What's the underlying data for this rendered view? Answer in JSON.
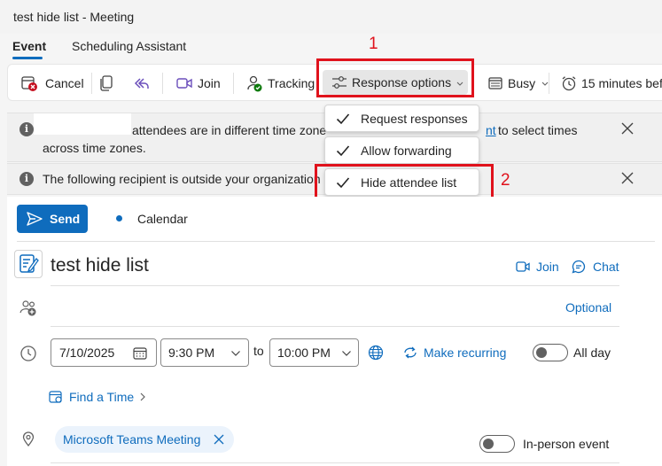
{
  "window": {
    "title": "test hide list - Meeting"
  },
  "tabs": [
    {
      "label": "Event",
      "active": true
    },
    {
      "label": "Scheduling Assistant",
      "active": false
    }
  ],
  "toolbar": {
    "cancel_label": "Cancel",
    "join_label": "Join",
    "tracking_label": "Tracking",
    "response_options_label": "Response options",
    "busy_label": "Busy",
    "reminder_label": "15 minutes bef"
  },
  "annotations": {
    "step1": "1",
    "step2": "2",
    "color": "#e0121c"
  },
  "infobars": {
    "timezone_text_before": "attendees are in different time zone",
    "timezone_link_fragment": "nt",
    "timezone_text_after": "to select times",
    "timezone_text_line2": "across time zones.",
    "external_text": "The following recipient is outside your organization"
  },
  "response_menu": {
    "items": [
      {
        "label": "Request responses",
        "checked": true
      },
      {
        "label": "Allow forwarding",
        "checked": true
      },
      {
        "label": "Hide attendee list",
        "checked": true
      }
    ]
  },
  "compose": {
    "send_label": "Send",
    "calendar_label": "Calendar",
    "title": "test hide list",
    "join_label": "Join",
    "chat_label": "Chat",
    "optional_label": "Optional",
    "start_date": "7/10/2025",
    "start_time": "9:30 PM",
    "to_label": "to",
    "end_time": "10:00 PM",
    "make_recurring_label": "Make recurring",
    "all_day_label": "All day",
    "find_time_label": "Find a Time",
    "teams_meeting_label": "Microsoft Teams Meeting",
    "in_person_label": "In-person event"
  },
  "colors": {
    "accent": "#0f6cbd",
    "cancel_red": "#c50f1f",
    "tracking_green": "#0e7a0d"
  },
  "icons": [
    "cancel-icon",
    "copy-icon",
    "reply-all-icon",
    "video-icon",
    "tracking-icon",
    "sliders-icon",
    "busy-icon",
    "alarm-icon",
    "info-icon",
    "close-icon",
    "check-icon",
    "send-icon",
    "note-icon",
    "people-add-icon",
    "clock-icon",
    "calendar-icon",
    "globe-icon",
    "repeat-icon",
    "find-time-icon",
    "location-icon"
  ]
}
